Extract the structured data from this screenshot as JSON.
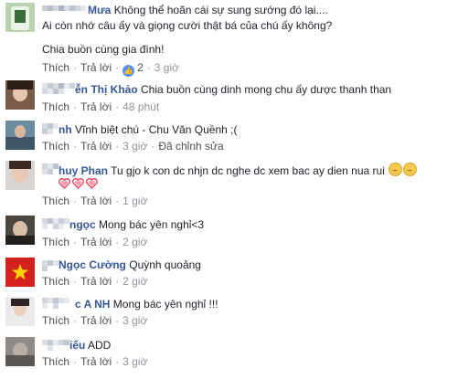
{
  "comments": [
    {
      "name": "Mưa",
      "lines": [
        "Không thể hoãn cái sự sung sướng đó lại....",
        "Ai còn nhớ câu ấy và giọng cười thật bá của chú ấy không?",
        "",
        "Chia buồn cùng gia đình!"
      ],
      "actions": {
        "like": "Thích",
        "reply": "Trả lời",
        "reactions": "2",
        "time": "3 giờ"
      }
    },
    {
      "name": "ễn Thị Khảo",
      "text": "Chia buồn cùng dinh mong chu ấy dược thanh than",
      "actions": {
        "like": "Thích",
        "reply": "Trả lời",
        "time": "48 phút"
      }
    },
    {
      "name": "nh",
      "text": "Vĩnh biệt chú - Chu Văn Quềnh ;(",
      "actions": {
        "like": "Thích",
        "reply": "Trả lời",
        "time": "3 giờ",
        "edited": "Đã chỉnh sửa"
      }
    },
    {
      "name": "huy Phan",
      "text": "Tu gjo k con dc nhjn dc nghe dc xem bac ay dien nua rui",
      "actions": {
        "like": "Thích",
        "reply": "Trả lời",
        "time": "1 giờ"
      }
    },
    {
      "name": "ngọc",
      "text": "Mong bác yên nghỉ<3",
      "actions": {
        "like": "Thích",
        "reply": "Trả lời",
        "time": "2 giờ"
      }
    },
    {
      "name": "Ngọc Cường",
      "text": "Quỳnh quoảng",
      "actions": {
        "like": "Thích",
        "reply": "Trả lời",
        "time": "2 giờ"
      }
    },
    {
      "name": "c A NH",
      "text": "Mong bác yên nghỉ !!!",
      "actions": {
        "like": "Thích",
        "reply": "Trả lời",
        "time": "3 giờ"
      }
    },
    {
      "name": "iếu",
      "text": "ADD",
      "actions": {
        "like": "Thích",
        "reply": "Trả lời",
        "time": "3 giờ"
      }
    }
  ],
  "colors": {
    "name": "#365899",
    "meta": "#90949c",
    "like_bubble": "#5890ff"
  },
  "icons": [
    "like-bubble-icon",
    "crying-emoji-icon",
    "heart-icon"
  ]
}
